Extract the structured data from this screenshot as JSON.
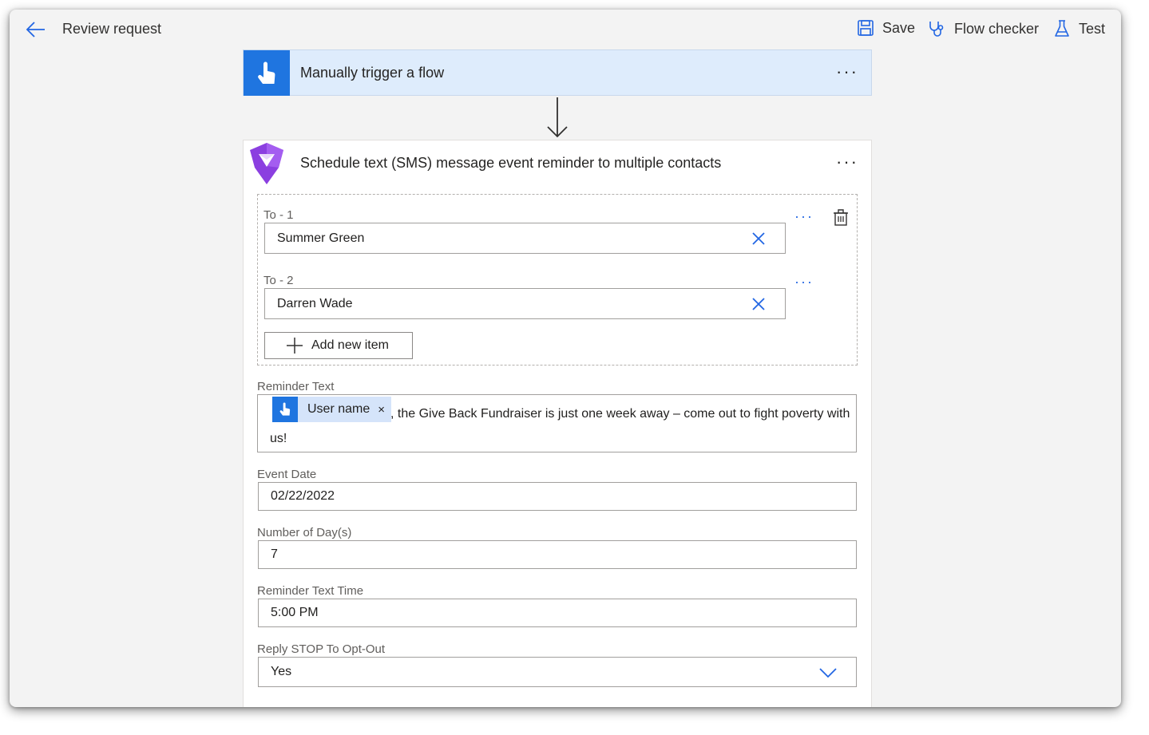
{
  "header": {
    "back_icon": "arrow-left-icon",
    "title": "Review request",
    "save_label": "Save",
    "flow_checker_label": "Flow checker",
    "test_label": "Test"
  },
  "trigger": {
    "title": "Manually trigger a flow",
    "more": "···"
  },
  "action": {
    "title": "Schedule text (SMS) message event reminder to multiple contacts",
    "more": "···",
    "to_items": [
      {
        "label": "To - 1",
        "value": "Summer Green"
      },
      {
        "label": "To - 2",
        "value": "Darren Wade"
      }
    ],
    "add_item_label": "Add new item",
    "reminder_text": {
      "label": "Reminder Text",
      "token_label": "User name",
      "token_close": "×",
      "text_line1": ", the Give Back Fundraiser is just one week away – come out to fight poverty with",
      "text_line2": "us!"
    },
    "event_date": {
      "label": "Event Date",
      "value": "02/22/2022"
    },
    "number_of_days": {
      "label": "Number of Day(s)",
      "value": "7"
    },
    "reminder_time": {
      "label": "Reminder Text Time",
      "value": "5:00 PM"
    },
    "reply_stop": {
      "label": "Reply STOP To Opt-Out",
      "value": "Yes"
    }
  },
  "colors": {
    "accent": "#1f75e0",
    "trigger_bg": "#deecfc",
    "link_blue": "#2266e3",
    "app_bg": "#f3f3f3"
  }
}
